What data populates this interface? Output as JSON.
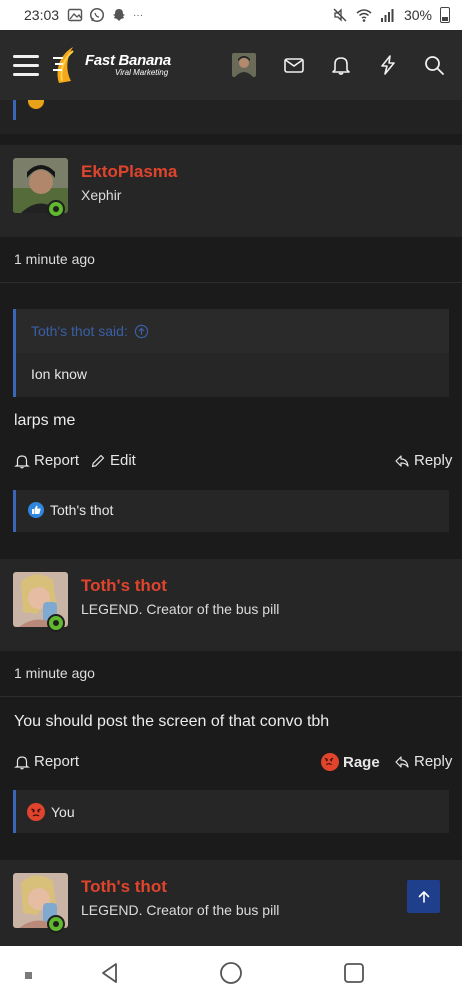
{
  "status_bar": {
    "time": "23:03",
    "notif_more": "···",
    "battery": "30%",
    "icons": [
      "gallery-icon",
      "whatsapp-icon",
      "snapchat-icon",
      "mute-icon",
      "wifi-icon",
      "signal-icon",
      "battery-icon"
    ]
  },
  "header": {
    "logo_title": "Fast Banana",
    "logo_subtitle": "Viral Marketing",
    "icons": [
      "menu-icon",
      "avatar",
      "mail-icon",
      "bell-icon",
      "bolt-icon",
      "search-icon"
    ]
  },
  "posts": [
    {
      "username": "EktoPlasma",
      "user_title": "Xephir",
      "time": "1 minute ago",
      "quote": {
        "author_line": "Toth's thot said:",
        "body": "Ion know"
      },
      "message": "larps me",
      "actions": {
        "report": "Report",
        "edit": "Edit",
        "reply": "Reply"
      },
      "reactions": "Toth's thot"
    },
    {
      "username": "Toth's thot",
      "user_title": "LEGEND. Creator of the bus pill",
      "time": "1 minute ago",
      "message": "You should post the screen of that convo tbh",
      "actions": {
        "report": "Report",
        "rage": "Rage",
        "reply": "Reply"
      },
      "reactions": "You"
    },
    {
      "username": "Toth's thot",
      "user_title": "LEGEND. Creator of the bus pill"
    }
  ],
  "colors": {
    "username": "#e0442c",
    "quote_accent": "#3a66b8",
    "online": "#5fb82e",
    "like": "#2e86de",
    "rage": "#e0442c",
    "scroll_top_btn": "#1f3f8c"
  }
}
